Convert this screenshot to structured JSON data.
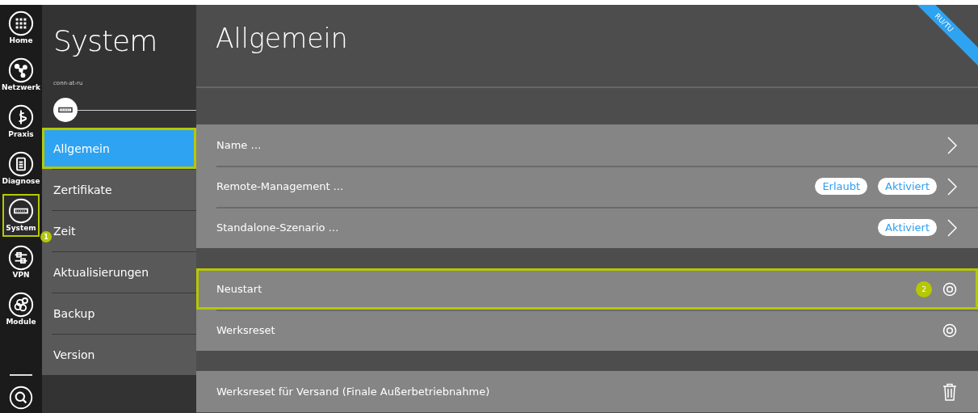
{
  "rail": {
    "items": [
      {
        "label": "Home",
        "selected": false,
        "highlighted": false
      },
      {
        "label": "Netzwerk",
        "selected": false,
        "highlighted": false
      },
      {
        "label": "Praxis",
        "selected": false,
        "highlighted": false
      },
      {
        "label": "Diagnose",
        "selected": false,
        "highlighted": false
      },
      {
        "label": "System",
        "selected": true,
        "highlighted": true,
        "marker": "1"
      },
      {
        "label": "VPN",
        "selected": false,
        "highlighted": false
      },
      {
        "label": "Module",
        "selected": false,
        "highlighted": false
      }
    ]
  },
  "subnav": {
    "title": "System",
    "subtitle": "conn-at-ru",
    "items": [
      {
        "label": "Allgemein",
        "selected": true,
        "highlighted": true
      },
      {
        "label": "Zertifikate",
        "selected": false,
        "highlighted": false
      },
      {
        "label": "Zeit",
        "selected": false,
        "highlighted": false
      },
      {
        "label": "Aktualisierungen",
        "selected": false,
        "highlighted": false
      },
      {
        "label": "Backup",
        "selected": false,
        "highlighted": false
      },
      {
        "label": "Version",
        "selected": false,
        "highlighted": false
      }
    ]
  },
  "main": {
    "title": "Allgemein",
    "ribbon": "RU/TU",
    "sections": [
      {
        "rows": [
          {
            "label": "Name …",
            "kind": "chevron",
            "badges": [],
            "highlighted": false
          },
          {
            "label": "Remote-Management …",
            "kind": "chevron",
            "badges": [
              "Erlaubt",
              "Aktiviert"
            ],
            "highlighted": false
          },
          {
            "label": "Standalone-Szenario …",
            "kind": "chevron",
            "badges": [
              "Aktiviert"
            ],
            "highlighted": false
          }
        ]
      },
      {
        "rows": [
          {
            "label": "Neustart",
            "kind": "action",
            "badges": [],
            "highlighted": true,
            "marker": "2"
          },
          {
            "label": "Werksreset",
            "kind": "action",
            "badges": [],
            "highlighted": false
          }
        ]
      },
      {
        "rows": [
          {
            "label": "Werksreset für Versand (Finale Außerbetriebnahme)",
            "kind": "delete",
            "badges": [],
            "highlighted": false
          }
        ]
      }
    ]
  }
}
